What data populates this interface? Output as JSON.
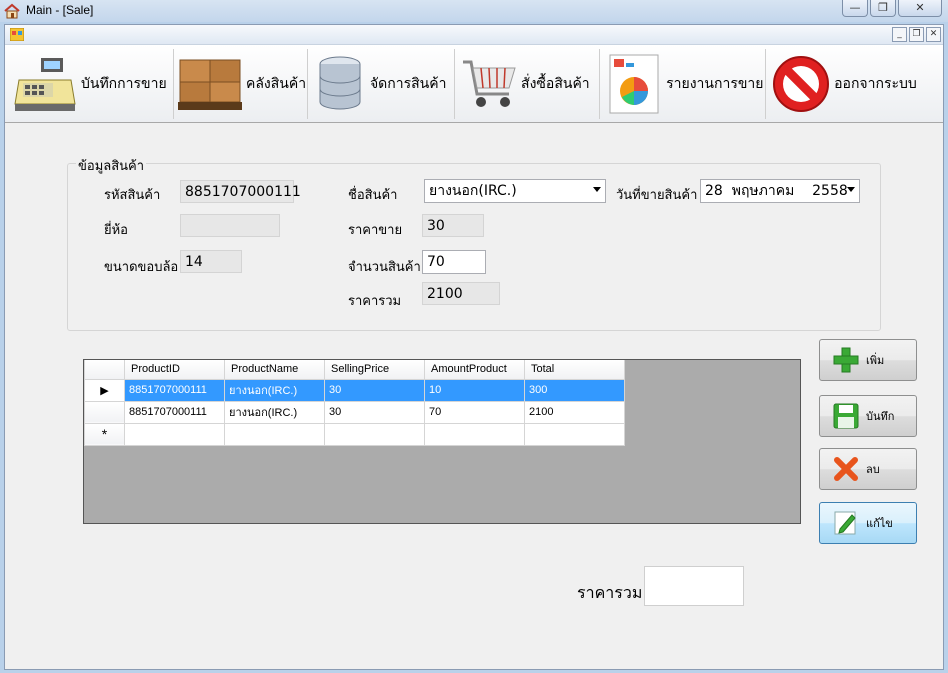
{
  "window": {
    "title": "Main - [Sale]"
  },
  "toolbar": {
    "items": [
      {
        "label": "บันทึกการขาย",
        "icon": "cash-register-icon"
      },
      {
        "label": "คลังสินค้า",
        "icon": "warehouse-boxes-icon"
      },
      {
        "label": "จัดการสินค้า",
        "icon": "database-icon"
      },
      {
        "label": "สั่งซื้อสินค้า",
        "icon": "shopping-cart-icon"
      },
      {
        "label": "รายงานการขาย",
        "icon": "report-chart-icon"
      },
      {
        "label": "ออกจากระบบ",
        "icon": "no-entry-icon"
      }
    ]
  },
  "product": {
    "group_title": "ข้อมูลสินค้า",
    "code_label": "รหัสสินค้า",
    "code_value": "8851707000111",
    "brand_label": "ยี่ห้อ",
    "brand_value": "",
    "wheel_label": "ขนาดขอบล้อ",
    "wheel_value": "14",
    "name_label": "ชื่อสินค้า",
    "name_value": "ยางนอก(IRC.)",
    "price_label": "ราคาขาย",
    "price_value": "30",
    "qty_label": "จำนวนสินค้า",
    "qty_value": "70",
    "sum_label": "ราคารวม",
    "sum_value": "2100",
    "date_label": "วันที่ขายสินค้า",
    "date_value": "28  พฤษภาคม    2558"
  },
  "grid": {
    "columns": [
      "ProductID",
      "ProductName",
      "SellingPrice",
      "AmountProduct",
      "Total"
    ],
    "rows": [
      [
        "8851707000111",
        "ยางนอก(IRC.)",
        "30",
        "10",
        "300"
      ],
      [
        "8851707000111",
        "ยางนอก(IRC.)",
        "30",
        "70",
        "2100"
      ]
    ],
    "selected_row": 0
  },
  "actions": {
    "add": "เพิ่ม",
    "save": "บันทึก",
    "delete": "ลบ",
    "edit": "แก้ไข"
  },
  "total": {
    "label": "ราคารวม",
    "value": ""
  }
}
